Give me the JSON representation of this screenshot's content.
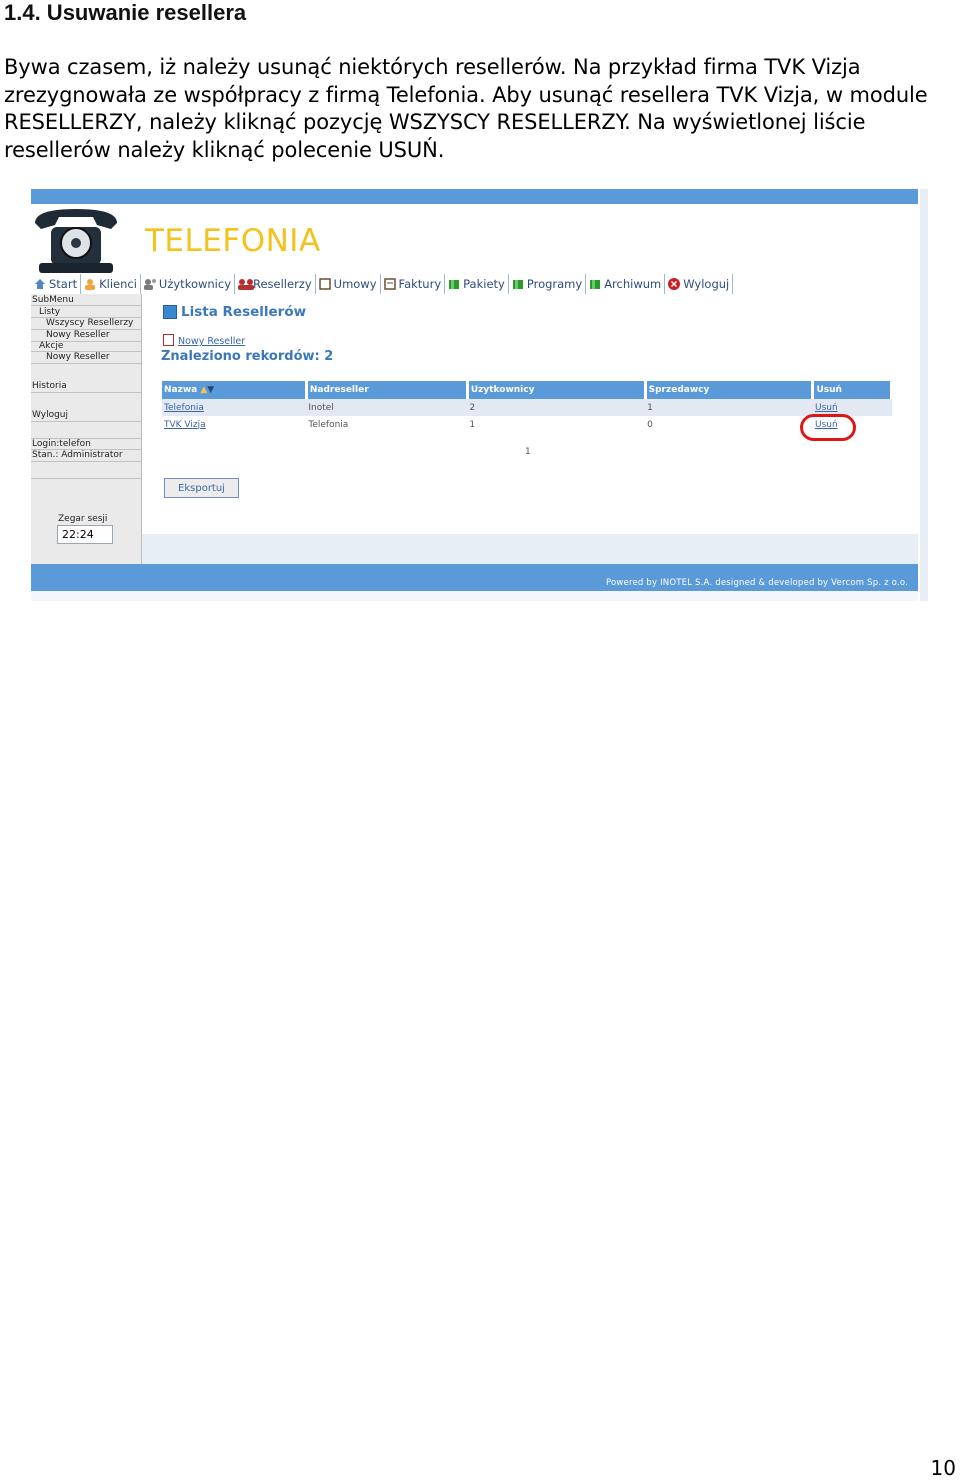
{
  "heading": "1.4. Usuwanie resellera",
  "paragraph": "Bywa czasem, iż należy usunąć niektórych resellerów. Na przykład firma TVK Vizja zrezygnowała ze współpracy z firmą Telefonia. Aby usunąć resellera TVK Vizja, w module RESELLERZY, należy kliknąć pozycję WSZYSCY RESELLERZY. Na wyświetlonej liście resellerów należy kliknąć polecenie USUŃ.",
  "page_number": "10",
  "app": {
    "brand": "TELEFONIA",
    "menu": [
      {
        "label": "Start",
        "icon": "home-icon",
        "color": "#4f86c6"
      },
      {
        "label": "Klienci",
        "icon": "user-icon",
        "color": "#f2a33a"
      },
      {
        "label": "Użytkownicy",
        "icon": "users-icon",
        "color": "#7a7a7a"
      },
      {
        "label": "Resellerzy",
        "icon": "resellers-icon",
        "color": "#b53030"
      },
      {
        "label": "Umowy",
        "icon": "document-icon",
        "color": "#6b4e2e"
      },
      {
        "label": "Faktury",
        "icon": "invoice-icon",
        "color": "#6b4e2e"
      },
      {
        "label": "Pakiety",
        "icon": "package-icon",
        "color": "#2a9b2a"
      },
      {
        "label": "Programy",
        "icon": "program-icon",
        "color": "#2a9b2a"
      },
      {
        "label": "Archiwum",
        "icon": "archive-icon",
        "color": "#2a9b2a"
      },
      {
        "label": "Wyloguj",
        "icon": "logout-icon",
        "color": "#c82020"
      }
    ],
    "sidebar": {
      "submenu": "SubMenu",
      "listy": "Listy",
      "wszyscy": "Wszyscy Resellerzy",
      "nowy1": "Nowy Reseller",
      "akcje": "Akcje",
      "nowy2": "Nowy Reseller",
      "historia": "Historia",
      "wyloguj": "Wyloguj",
      "login": "Login:telefon",
      "stan": "Stan.: Administrator",
      "zegar_label": "Zegar sesji",
      "zegar_value": "22:24"
    },
    "content": {
      "lista_title": "Lista Resellerów",
      "nowy_link": "Nowy Reseller",
      "records": "Znaleziono rekordów: 2",
      "table": {
        "headers": [
          "Nazwa",
          "Nadreseller",
          "Uzytkownicy",
          "Sprzedawcy",
          "Usuń"
        ],
        "rows": [
          [
            "Telefonia",
            "Inotel",
            "2",
            "1",
            "Usuń"
          ],
          [
            "TVK Vizja",
            "Telefonia",
            "1",
            "0",
            "Usuń"
          ]
        ]
      },
      "pager": "1",
      "export": "Eksportuj"
    },
    "footer": "Powered by INOTEL S.A. designed & developed by Vercom Sp. z o.o."
  }
}
